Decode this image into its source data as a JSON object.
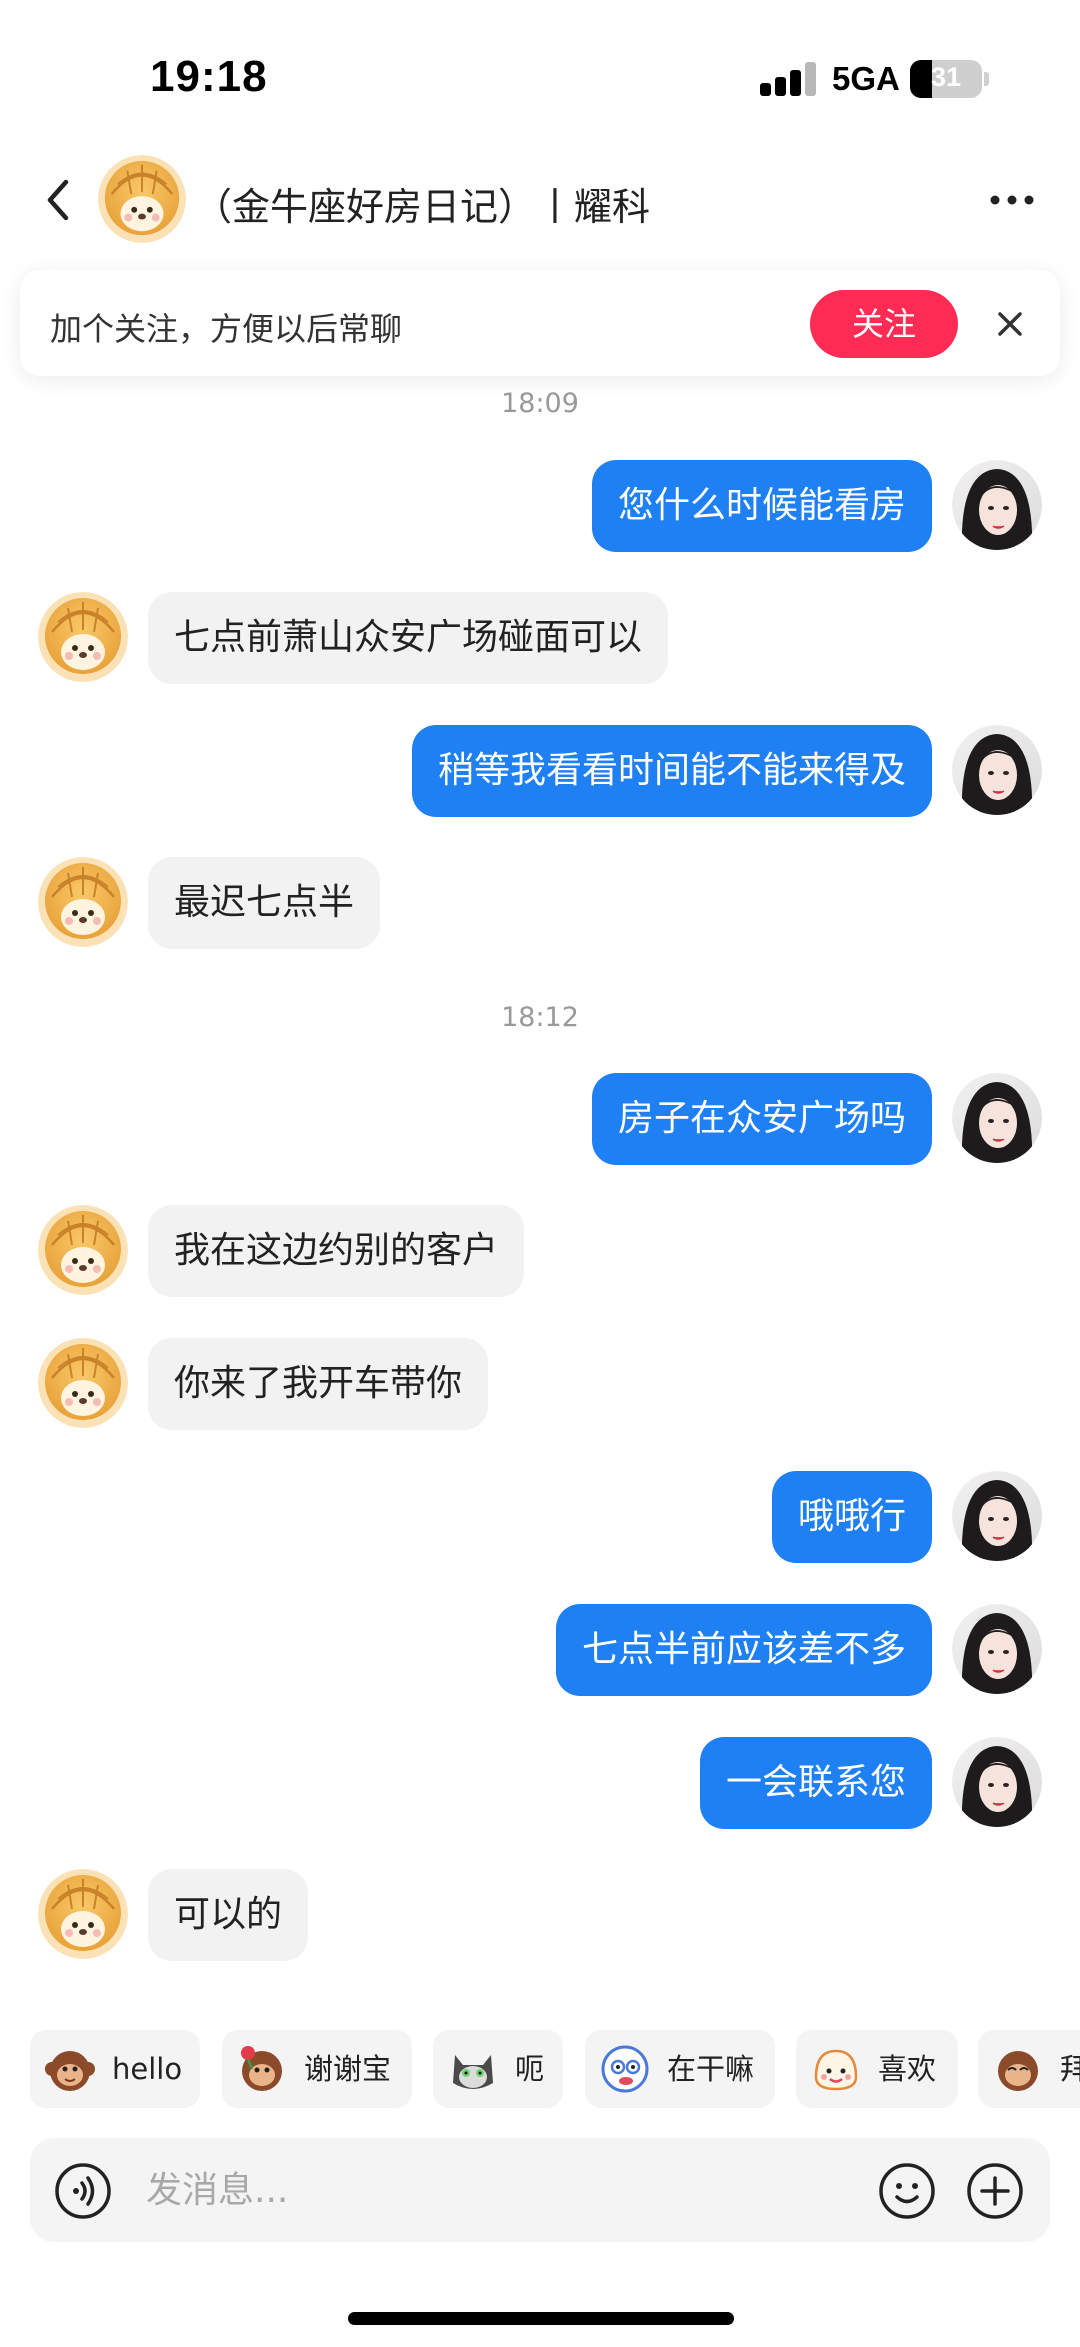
{
  "status_bar": {
    "time": "19:18",
    "network": "5GA",
    "battery": "31",
    "battery_level": 0.31
  },
  "header": {
    "title": "（金牛座好房日记）丨耀科",
    "back_icon": "chevron-left-icon",
    "more_icon": "more-horizontal-icon"
  },
  "follow_banner": {
    "text": "加个关注，方便以后常聊",
    "button_label": "关注",
    "close_icon": "close-icon",
    "accent": "#fe2c55"
  },
  "chat": {
    "timestamps": [
      "18:09",
      "18:12"
    ],
    "messages": [
      {
        "from": "me",
        "text": "您什么时候能看房"
      },
      {
        "from": "them",
        "text": "七点前萧山众安广场碰面可以"
      },
      {
        "from": "me",
        "text": "稍等我看看时间能不能来得及"
      },
      {
        "from": "them",
        "text": "最迟七点半"
      },
      {
        "from": "me",
        "text": "房子在众安广场吗"
      },
      {
        "from": "them",
        "text": "我在这边约别的客户"
      },
      {
        "from": "them",
        "text": "你来了我开车带你"
      },
      {
        "from": "me",
        "text": "哦哦行"
      },
      {
        "from": "me",
        "text": "七点半前应该差不多"
      },
      {
        "from": "me",
        "text": "一会联系您"
      },
      {
        "from": "them",
        "text": "可以的"
      }
    ],
    "outgoing_color": "#1f80f4",
    "incoming_color": "#f2f2f2"
  },
  "quick_replies": [
    {
      "label": "hello",
      "icon": "monkey-emoji-icon"
    },
    {
      "label": "谢谢宝",
      "icon": "monkey-rose-emoji-icon"
    },
    {
      "label": "呃",
      "icon": "cat-emoji-icon"
    },
    {
      "label": "在干嘛",
      "icon": "peeking-emoji-icon"
    },
    {
      "label": "喜欢",
      "icon": "cute-emoji-icon"
    },
    {
      "label": "拜",
      "icon": "monkey-bye-emoji-icon"
    }
  ],
  "input": {
    "placeholder": "发消息...",
    "voice_icon": "voice-icon",
    "emoji_icon": "smiley-icon",
    "plus_icon": "plus-circle-icon"
  }
}
